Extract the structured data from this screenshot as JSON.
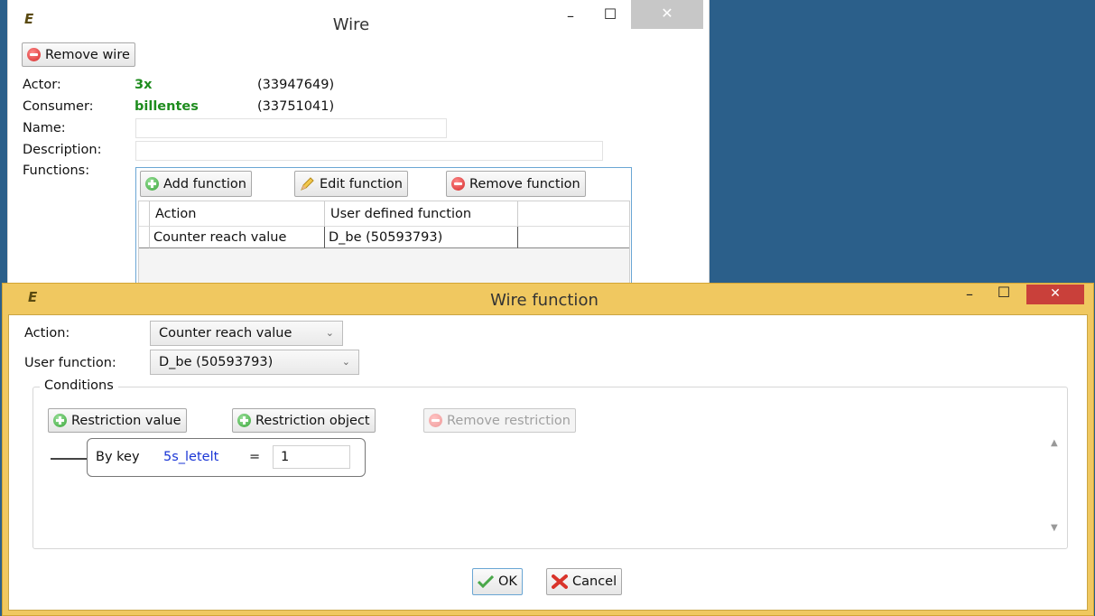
{
  "wire_window": {
    "title": "Wire",
    "logo": "E",
    "controls": {
      "minimize": "–",
      "maximize": "☐",
      "close": "✕"
    },
    "remove_wire_label": "Remove wire",
    "actor_label": "Actor:",
    "actor_value": "3x",
    "actor_id": "(33947649)",
    "consumer_label": "Consumer:",
    "consumer_value": "billentes",
    "consumer_id": "(33751041)",
    "name_label": "Name:",
    "name_value": "",
    "description_label": "Description:",
    "description_value": "",
    "functions_label": "Functions:",
    "add_function_label": "Add function",
    "edit_function_label": "Edit function",
    "remove_function_label": "Remove function",
    "table": {
      "columns": [
        "Action",
        "User defined function"
      ],
      "rows": [
        {
          "action": "Counter reach value",
          "function": "D_be (50593793)"
        }
      ]
    }
  },
  "function_window": {
    "title": "Wire function",
    "logo": "E",
    "controls": {
      "minimize": "–",
      "maximize": "☐",
      "close": "✕"
    },
    "action_label": "Action:",
    "action_value": "Counter reach value",
    "user_function_label": "User function:",
    "user_function_value": "D_be (50593793)",
    "conditions_label": "Conditions",
    "restriction_value_label": "Restriction value",
    "restriction_object_label": "Restriction object",
    "remove_restriction_label": "Remove restriction",
    "condition": {
      "prefix": "By key",
      "key": "5s_letelt",
      "operator": "=",
      "value": "1"
    },
    "ok_label": "OK",
    "cancel_label": "Cancel"
  },
  "colors": {
    "desktop": "#2b5f8a",
    "active_title": "#f0c860",
    "close_red": "#c9403a",
    "green_text": "#1e8c1e",
    "key_blue": "#1a36d6"
  }
}
